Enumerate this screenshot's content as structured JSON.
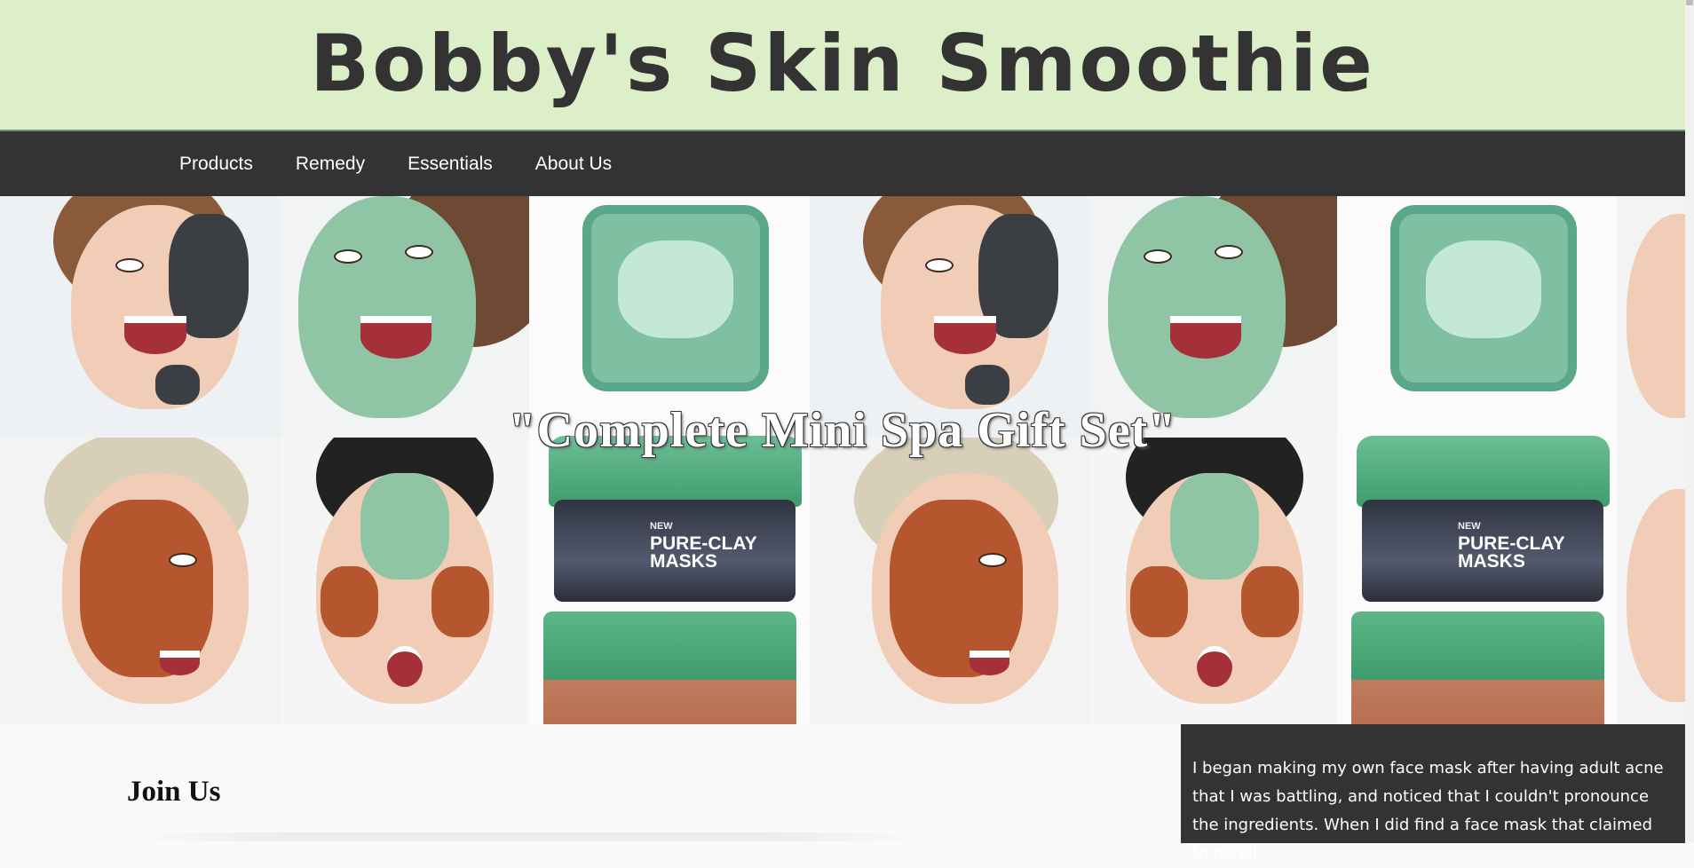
{
  "header": {
    "title": "Bobby's Skin Smoothie"
  },
  "nav": {
    "items": [
      {
        "label": "Products"
      },
      {
        "label": "Remedy"
      },
      {
        "label": "Essentials"
      },
      {
        "label": "About Us"
      }
    ]
  },
  "hero": {
    "caption": "\"Complete Mini Spa Gift Set\"",
    "jar_badge_new": "NEW",
    "jar_brand": "PURE-CLAY MASKS"
  },
  "main": {
    "join_title": "Join Us",
    "story": "I began making my own face mask after having adult acne that I was battling, and noticed that I couldn't pronounce the ingredients. When I did find a face mask that claimed to be all"
  },
  "colors": {
    "header_bg": "#dcefc8",
    "nav_bg": "#333333",
    "story_bg": "#333333"
  }
}
